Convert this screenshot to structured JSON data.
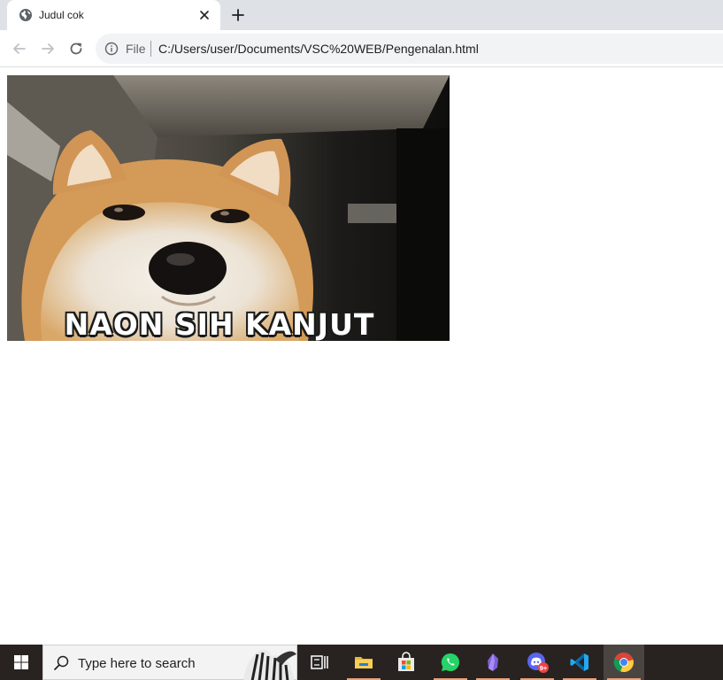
{
  "browser": {
    "tab_title": "Judul cok",
    "address_scheme": "File",
    "address_url": "C:/Users/user/Documents/VSC%20WEB/Pengenalan.html"
  },
  "page": {
    "meme_caption": "NAON SIH KANJUT"
  },
  "taskbar": {
    "search_placeholder": "Type here to search",
    "chat_badge": "9+",
    "apps": [
      "task-view-icon",
      "file-explorer-icon",
      "microsoft-store-icon",
      "whatsapp-icon",
      "obsidian-icon",
      "discord-icon",
      "vscode-icon",
      "chrome-icon"
    ]
  },
  "colors": {
    "tabstrip": "#dee1e6",
    "omnibox": "#f1f3f4",
    "taskbar": "#282320",
    "running_indicator": "#e8a37c"
  }
}
